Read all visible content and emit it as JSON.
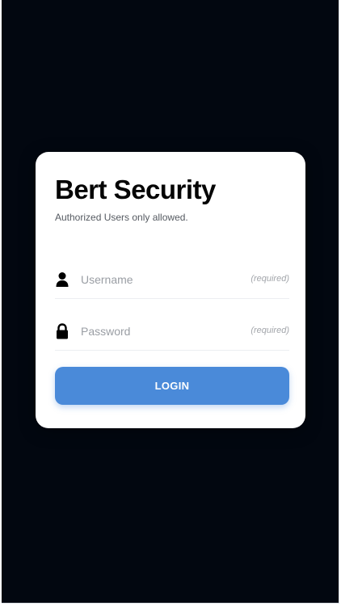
{
  "app": {
    "title": "Bert Security",
    "subtitle": "Authorized Users only allowed."
  },
  "form": {
    "username": {
      "placeholder": "Username",
      "value": "",
      "hint": "(required)",
      "icon": "user-icon"
    },
    "password": {
      "placeholder": "Password",
      "value": "",
      "hint": "(required)",
      "icon": "lock-icon"
    },
    "login_label": "LOGIN"
  },
  "colors": {
    "background": "#020710",
    "card": "#ffffff",
    "accent": "#4a8ad9"
  }
}
